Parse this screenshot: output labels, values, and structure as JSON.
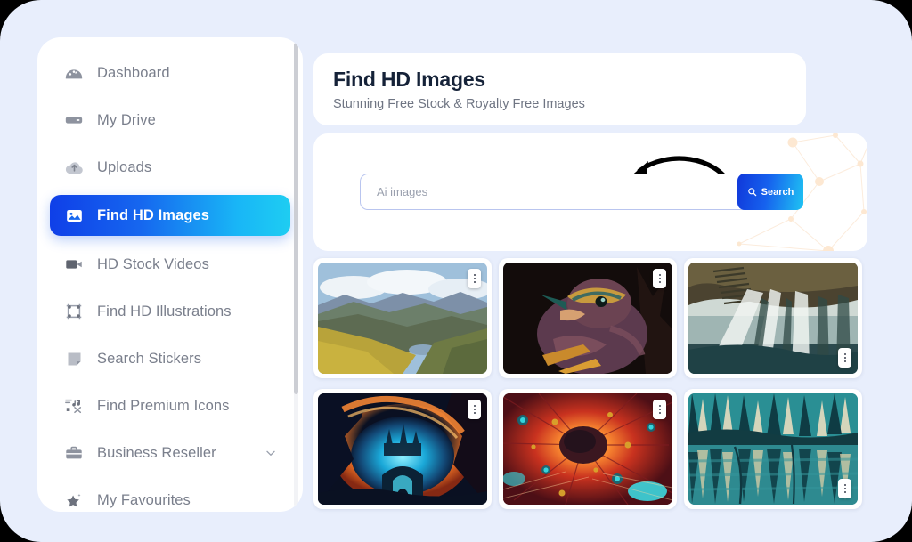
{
  "theme": {
    "frame_bg": "#e8eefc",
    "panel_bg": "#ffffff",
    "accent_blue": "#1038da",
    "accent_cyan": "#1ecdf2",
    "muted_text": "#7a7f8c",
    "title_text": "#152238"
  },
  "sidebar": {
    "items": [
      {
        "label": "Dashboard",
        "icon": "speedometer-icon",
        "active": false,
        "chevron": false
      },
      {
        "label": "My Drive",
        "icon": "hard-drive-icon",
        "active": false,
        "chevron": false
      },
      {
        "label": "Uploads",
        "icon": "cloud-upload-icon",
        "active": false,
        "chevron": false
      },
      {
        "label": "Find HD Images",
        "icon": "image-icon",
        "active": true,
        "chevron": false
      },
      {
        "label": "HD Stock Videos",
        "icon": "video-camera-icon",
        "active": false,
        "chevron": false
      },
      {
        "label": "Find HD Illustrations",
        "icon": "crop-frame-icon",
        "active": false,
        "chevron": false
      },
      {
        "label": "Search Stickers",
        "icon": "sticker-icon",
        "active": false,
        "chevron": false
      },
      {
        "label": "Find Premium Icons",
        "icon": "icon-set-icon",
        "active": false,
        "chevron": false
      },
      {
        "label": "Business Reseller",
        "icon": "briefcase-icon",
        "active": false,
        "chevron": true
      },
      {
        "label": "My Favourites",
        "icon": "star-sparkle-icon",
        "active": false,
        "chevron": false
      }
    ]
  },
  "header": {
    "title": "Find HD Images",
    "subtitle": "Stunning Free Stock & Royalty Free Images"
  },
  "search": {
    "value": "",
    "placeholder": "Ai images",
    "button_label": "Search",
    "button_icon": "search-icon",
    "annotation": "curved-arrow-pointing-to-search-input"
  },
  "gallery": {
    "menu_icon": "kebab-menu-icon",
    "cards": [
      {
        "name": "mountain-valley-landscape",
        "menu_position": "top-right"
      },
      {
        "name": "colorful-bird-portrait",
        "menu_position": "top-right"
      },
      {
        "name": "cave-light-rays",
        "menu_position": "bottom-right"
      },
      {
        "name": "fantasy-fire-portal",
        "menu_position": "top-right"
      },
      {
        "name": "abstract-red-explosion",
        "menu_position": "top-right"
      },
      {
        "name": "teal-forest-lake",
        "menu_position": "bottom-right"
      }
    ]
  }
}
